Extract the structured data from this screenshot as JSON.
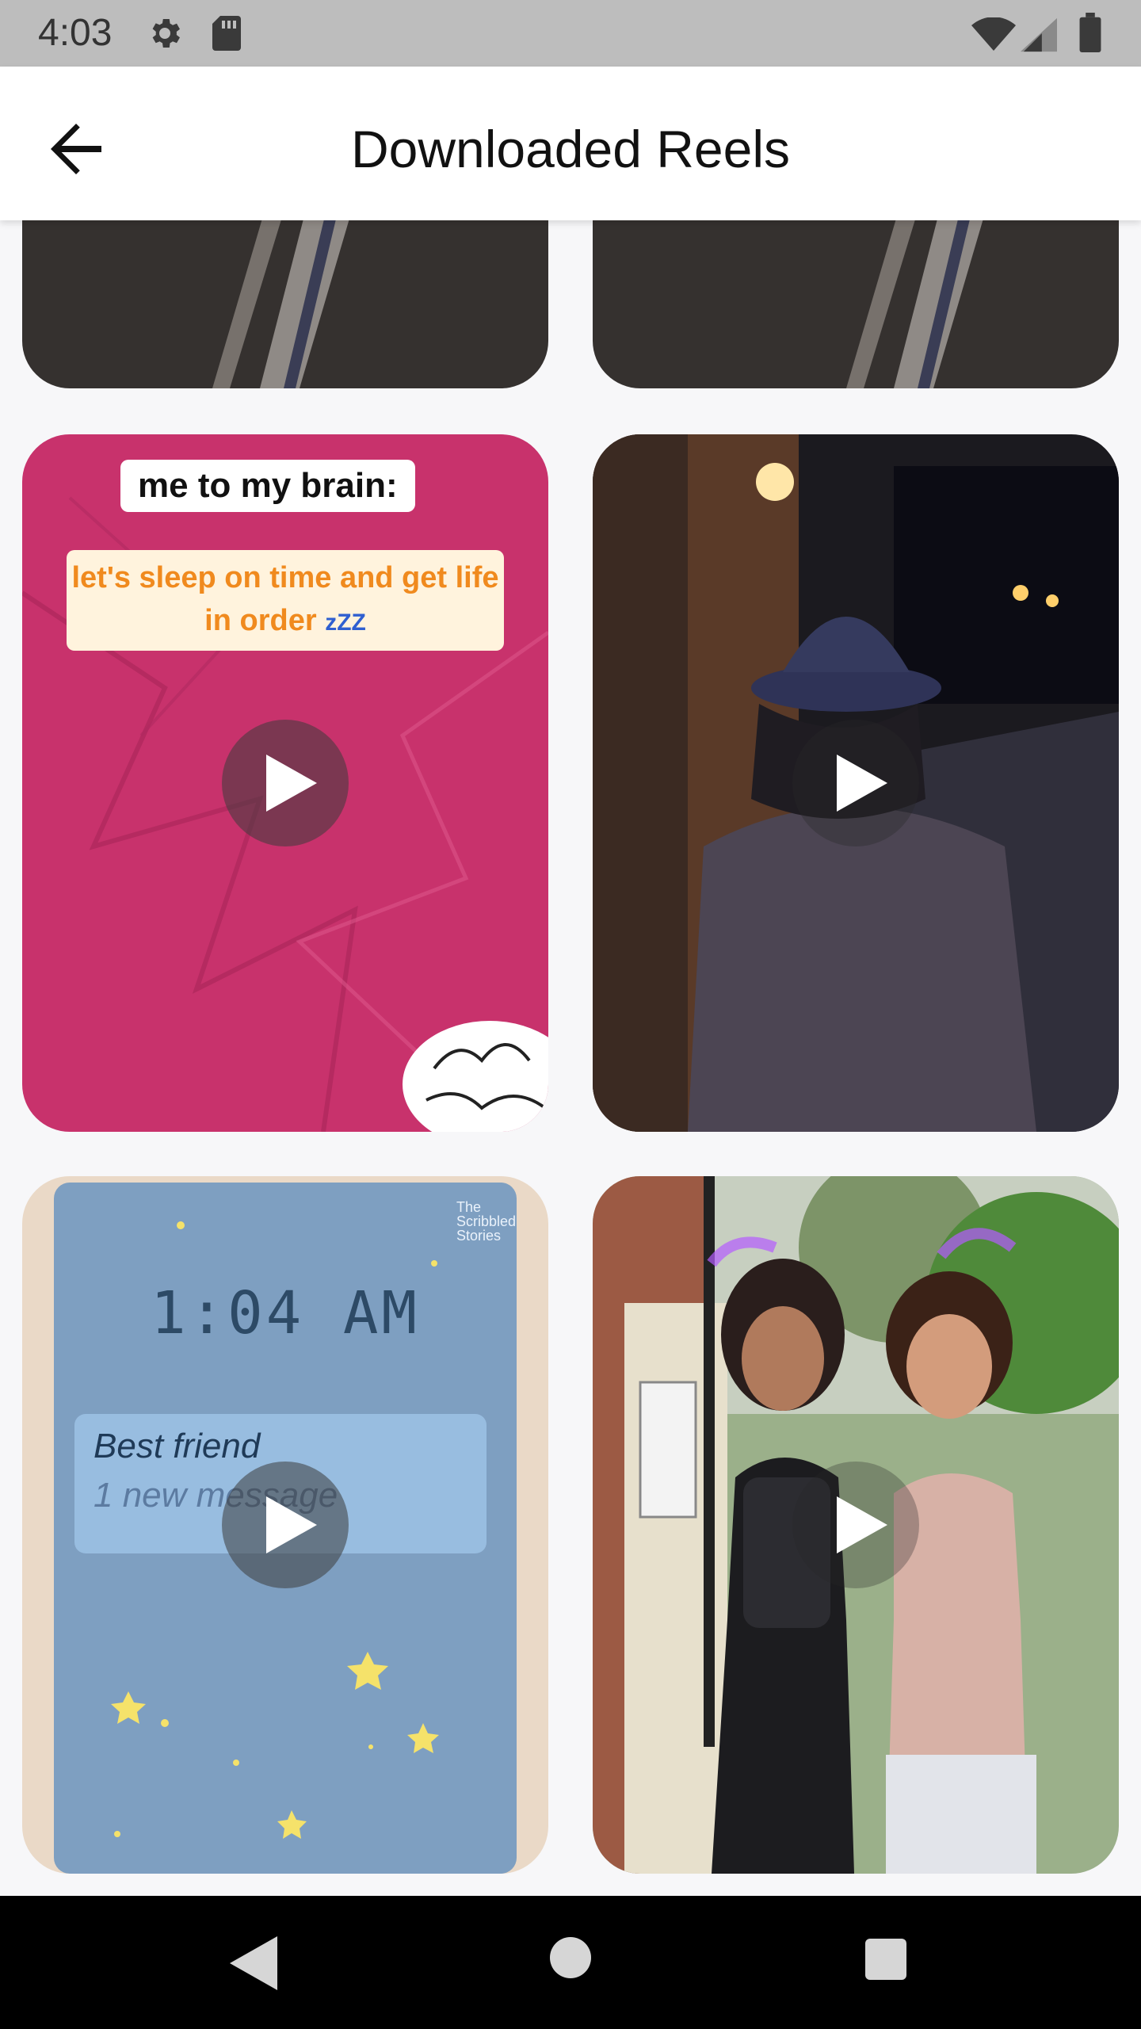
{
  "status_bar": {
    "time": "4:03"
  },
  "app_bar": {
    "title": "Downloaded Reels"
  },
  "reels": [
    {
      "caption_top": "me to my brain:",
      "caption_main": "let's sleep on time and get life in order",
      "caption_tail": "zZZ"
    },
    {},
    {
      "clock": "1:04 AM",
      "notification_title": "Best friend",
      "notification_sub": "1 new message",
      "brand": "The Scribbled Stories"
    },
    {}
  ],
  "colors": {
    "app_bar": "#ffffff",
    "status_bar": "#bdbdbd",
    "accent_orange": "#f08a1e",
    "pink": "#c8326c",
    "blue_card": "#7e9fc1"
  }
}
